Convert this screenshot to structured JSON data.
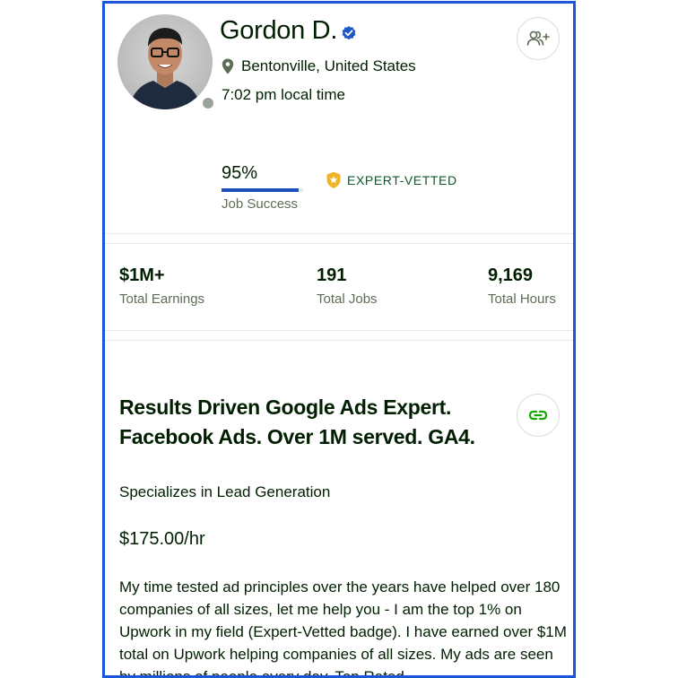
{
  "profile": {
    "name": "Gordon D.",
    "location": "Bentonville, United States",
    "local_time": "7:02 pm local time",
    "status": "offline"
  },
  "job_success": {
    "percent_text": "95%",
    "percent": 95,
    "label": "Job Success"
  },
  "badge": {
    "label": "EXPERT-VETTED"
  },
  "stats": [
    {
      "value": "$1M+",
      "label": "Total Earnings"
    },
    {
      "value": "191",
      "label": "Total Jobs"
    },
    {
      "value": "9,169",
      "label": "Total Hours"
    }
  ],
  "headline": "Results Driven Google Ads Expert. Facebook Ads. Over 1M served. GA4.",
  "specialization": "Specializes in Lead Generation",
  "rate": "$175.00/hr",
  "description": "My time tested ad principles over the years have helped over 180 companies of all sizes, let me help you - I am the top 1% on Upwork in my field (Expert-Vetted badge). I have earned over $1M total on Upwork helping companies of all sizes. My ads are seen by millions of people every day. Top Rated...",
  "colors": {
    "frame_border": "#1a56db",
    "brand_green": "#14a800",
    "progress": "#1d4fb8",
    "badge_gold": "#f0b429"
  },
  "icons": {
    "verified": "verified-check-icon",
    "location": "map-pin-icon",
    "add_user": "add-user-icon",
    "badge": "shield-star-icon",
    "link": "link-icon"
  }
}
